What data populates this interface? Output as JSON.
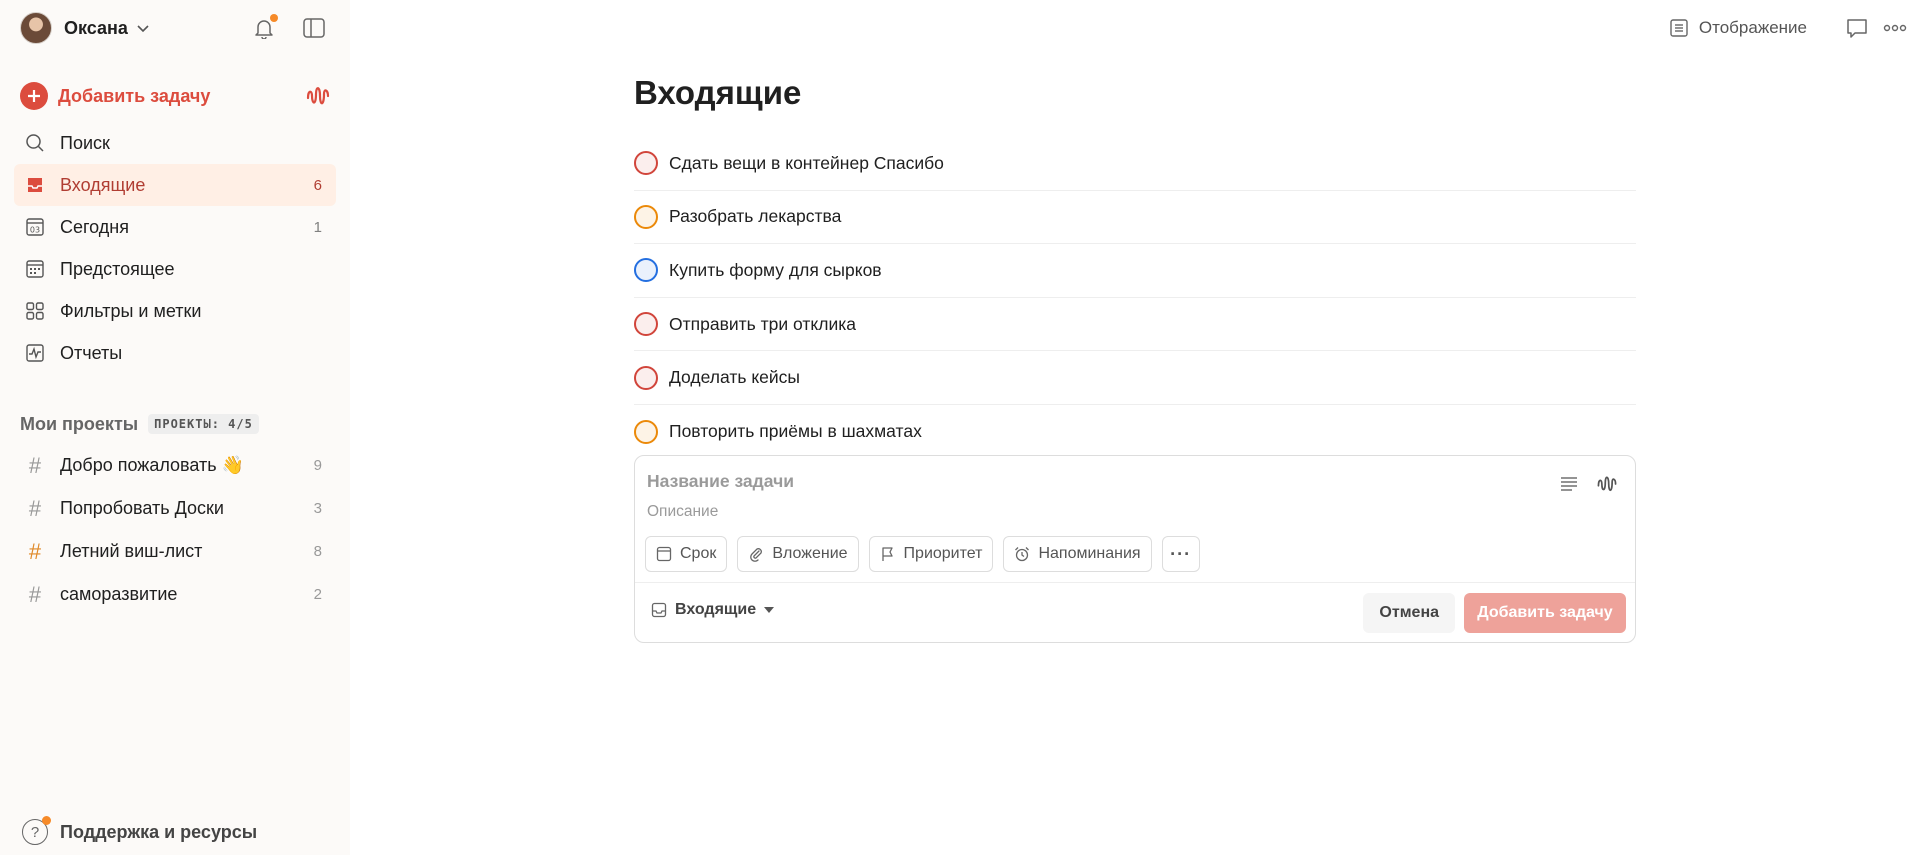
{
  "colors": {
    "accent": "#dc4c3e",
    "active_bg": "#ffefe5",
    "notification_dot": "#f68a28",
    "priority_1": "#d1453b",
    "priority_2": "#eb8909",
    "priority_3": "#246fe0",
    "add_button_disabled": "#eea29a"
  },
  "sidebar": {
    "user_name": "Оксана",
    "add_task_label": "Добавить задачу",
    "nav": [
      {
        "label": "Поиск",
        "icon": "search-icon",
        "count": ""
      },
      {
        "label": "Входящие",
        "icon": "inbox-icon",
        "count": "6"
      },
      {
        "label": "Сегодня",
        "icon": "calendar-today-icon",
        "count": "1",
        "day": "03"
      },
      {
        "label": "Предстоящее",
        "icon": "calendar-grid-icon",
        "count": ""
      },
      {
        "label": "Фильтры и метки",
        "icon": "filters-icon",
        "count": ""
      },
      {
        "label": "Отчеты",
        "icon": "reports-icon",
        "count": ""
      }
    ],
    "projects_title": "Мои проекты",
    "projects_badge": "ПРОЕКТЫ: 4/5",
    "projects": [
      {
        "label": "Добро пожаловать 👋",
        "count": "9"
      },
      {
        "label": "Попробовать Доски",
        "count": "3"
      },
      {
        "label": "Летний виш-лист",
        "count": "8"
      },
      {
        "label": "саморазвитие",
        "count": "2"
      }
    ],
    "support_label": "Поддержка и ресурсы"
  },
  "topbar": {
    "view_label": "Отображение"
  },
  "main": {
    "title": "Входящие",
    "tasks": [
      {
        "label": "Сдать вещи в контейнер Спасибо",
        "priority": 1
      },
      {
        "label": "Разобрать лекарства",
        "priority": 2
      },
      {
        "label": "Купить форму для сырков",
        "priority": 3
      },
      {
        "label": "Отправить три отклика",
        "priority": 1
      },
      {
        "label": "Доделать кейсы",
        "priority": 1
      },
      {
        "label": "Повторить приёмы в шахматах",
        "priority": 2
      }
    ],
    "editor": {
      "title_placeholder": "Название задачи",
      "description_placeholder": "Описание",
      "chips": {
        "due": "Срок",
        "attachment": "Вложение",
        "priority": "Приоритет",
        "reminders": "Напоминания",
        "more": "···"
      },
      "project": "Входящие",
      "cancel": "Отмена",
      "submit": "Добавить задачу"
    }
  }
}
